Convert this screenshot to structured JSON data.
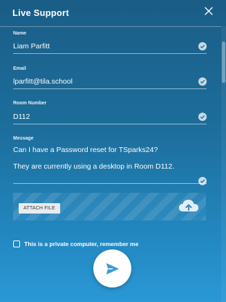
{
  "window": {
    "title": "Live Support"
  },
  "form": {
    "name_label": "Name",
    "name_value": "Liam Parfitt",
    "email_label": "Email",
    "email_value": "lparfitt@tila.school",
    "room_label": "Room Number",
    "room_value": "D112",
    "message_label": "Message",
    "message_lines": [
      "Can I have a Password reset for TSparks24?",
      "They are currently using a desktop in Room D112."
    ],
    "attach_label": "ATTACH FILE",
    "remember_label": "This is a private computer, remember me"
  },
  "colors": {
    "background_top": "#1a5d86",
    "background_bottom": "#2a98d6",
    "send_icon": "#3a9bd9"
  },
  "icons": {
    "close": "close-icon",
    "check": "check-circle-icon",
    "upload": "cloud-upload-icon",
    "send": "send-icon"
  }
}
